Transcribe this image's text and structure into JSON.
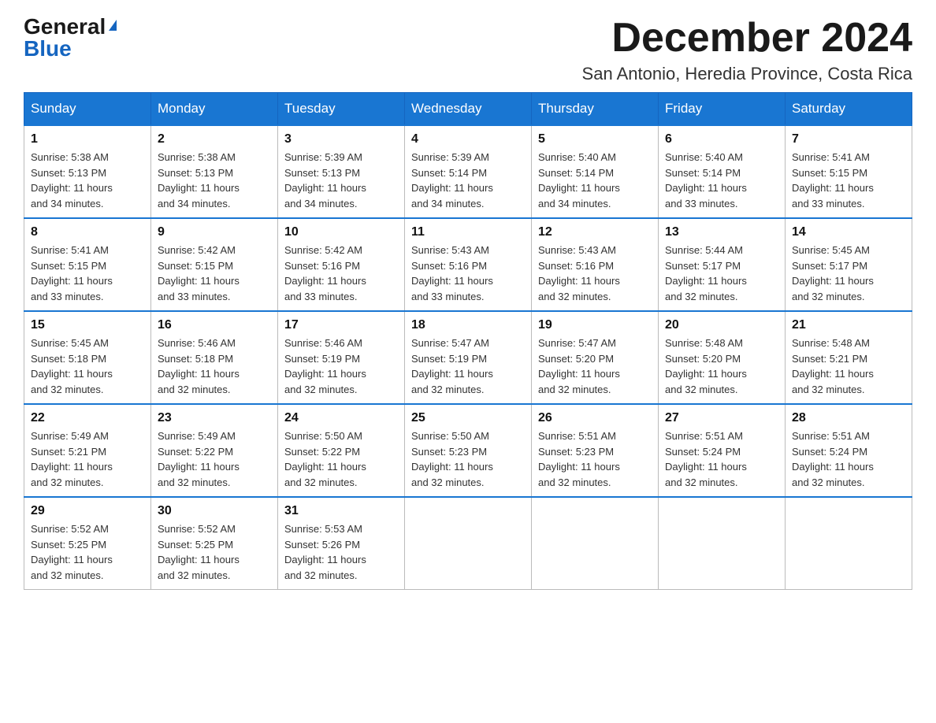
{
  "header": {
    "logo_general": "General",
    "logo_blue": "Blue",
    "month_title": "December 2024",
    "subtitle": "San Antonio, Heredia Province, Costa Rica"
  },
  "days_of_week": [
    "Sunday",
    "Monday",
    "Tuesday",
    "Wednesday",
    "Thursday",
    "Friday",
    "Saturday"
  ],
  "weeks": [
    [
      {
        "day": "1",
        "sunrise": "5:38 AM",
        "sunset": "5:13 PM",
        "daylight": "11 hours and 34 minutes."
      },
      {
        "day": "2",
        "sunrise": "5:38 AM",
        "sunset": "5:13 PM",
        "daylight": "11 hours and 34 minutes."
      },
      {
        "day": "3",
        "sunrise": "5:39 AM",
        "sunset": "5:13 PM",
        "daylight": "11 hours and 34 minutes."
      },
      {
        "day": "4",
        "sunrise": "5:39 AM",
        "sunset": "5:14 PM",
        "daylight": "11 hours and 34 minutes."
      },
      {
        "day": "5",
        "sunrise": "5:40 AM",
        "sunset": "5:14 PM",
        "daylight": "11 hours and 34 minutes."
      },
      {
        "day": "6",
        "sunrise": "5:40 AM",
        "sunset": "5:14 PM",
        "daylight": "11 hours and 33 minutes."
      },
      {
        "day": "7",
        "sunrise": "5:41 AM",
        "sunset": "5:15 PM",
        "daylight": "11 hours and 33 minutes."
      }
    ],
    [
      {
        "day": "8",
        "sunrise": "5:41 AM",
        "sunset": "5:15 PM",
        "daylight": "11 hours and 33 minutes."
      },
      {
        "day": "9",
        "sunrise": "5:42 AM",
        "sunset": "5:15 PM",
        "daylight": "11 hours and 33 minutes."
      },
      {
        "day": "10",
        "sunrise": "5:42 AM",
        "sunset": "5:16 PM",
        "daylight": "11 hours and 33 minutes."
      },
      {
        "day": "11",
        "sunrise": "5:43 AM",
        "sunset": "5:16 PM",
        "daylight": "11 hours and 33 minutes."
      },
      {
        "day": "12",
        "sunrise": "5:43 AM",
        "sunset": "5:16 PM",
        "daylight": "11 hours and 32 minutes."
      },
      {
        "day": "13",
        "sunrise": "5:44 AM",
        "sunset": "5:17 PM",
        "daylight": "11 hours and 32 minutes."
      },
      {
        "day": "14",
        "sunrise": "5:45 AM",
        "sunset": "5:17 PM",
        "daylight": "11 hours and 32 minutes."
      }
    ],
    [
      {
        "day": "15",
        "sunrise": "5:45 AM",
        "sunset": "5:18 PM",
        "daylight": "11 hours and 32 minutes."
      },
      {
        "day": "16",
        "sunrise": "5:46 AM",
        "sunset": "5:18 PM",
        "daylight": "11 hours and 32 minutes."
      },
      {
        "day": "17",
        "sunrise": "5:46 AM",
        "sunset": "5:19 PM",
        "daylight": "11 hours and 32 minutes."
      },
      {
        "day": "18",
        "sunrise": "5:47 AM",
        "sunset": "5:19 PM",
        "daylight": "11 hours and 32 minutes."
      },
      {
        "day": "19",
        "sunrise": "5:47 AM",
        "sunset": "5:20 PM",
        "daylight": "11 hours and 32 minutes."
      },
      {
        "day": "20",
        "sunrise": "5:48 AM",
        "sunset": "5:20 PM",
        "daylight": "11 hours and 32 minutes."
      },
      {
        "day": "21",
        "sunrise": "5:48 AM",
        "sunset": "5:21 PM",
        "daylight": "11 hours and 32 minutes."
      }
    ],
    [
      {
        "day": "22",
        "sunrise": "5:49 AM",
        "sunset": "5:21 PM",
        "daylight": "11 hours and 32 minutes."
      },
      {
        "day": "23",
        "sunrise": "5:49 AM",
        "sunset": "5:22 PM",
        "daylight": "11 hours and 32 minutes."
      },
      {
        "day": "24",
        "sunrise": "5:50 AM",
        "sunset": "5:22 PM",
        "daylight": "11 hours and 32 minutes."
      },
      {
        "day": "25",
        "sunrise": "5:50 AM",
        "sunset": "5:23 PM",
        "daylight": "11 hours and 32 minutes."
      },
      {
        "day": "26",
        "sunrise": "5:51 AM",
        "sunset": "5:23 PM",
        "daylight": "11 hours and 32 minutes."
      },
      {
        "day": "27",
        "sunrise": "5:51 AM",
        "sunset": "5:24 PM",
        "daylight": "11 hours and 32 minutes."
      },
      {
        "day": "28",
        "sunrise": "5:51 AM",
        "sunset": "5:24 PM",
        "daylight": "11 hours and 32 minutes."
      }
    ],
    [
      {
        "day": "29",
        "sunrise": "5:52 AM",
        "sunset": "5:25 PM",
        "daylight": "11 hours and 32 minutes."
      },
      {
        "day": "30",
        "sunrise": "5:52 AM",
        "sunset": "5:25 PM",
        "daylight": "11 hours and 32 minutes."
      },
      {
        "day": "31",
        "sunrise": "5:53 AM",
        "sunset": "5:26 PM",
        "daylight": "11 hours and 32 minutes."
      },
      null,
      null,
      null,
      null
    ]
  ],
  "labels": {
    "sunrise": "Sunrise:",
    "sunset": "Sunset:",
    "daylight": "Daylight:"
  }
}
